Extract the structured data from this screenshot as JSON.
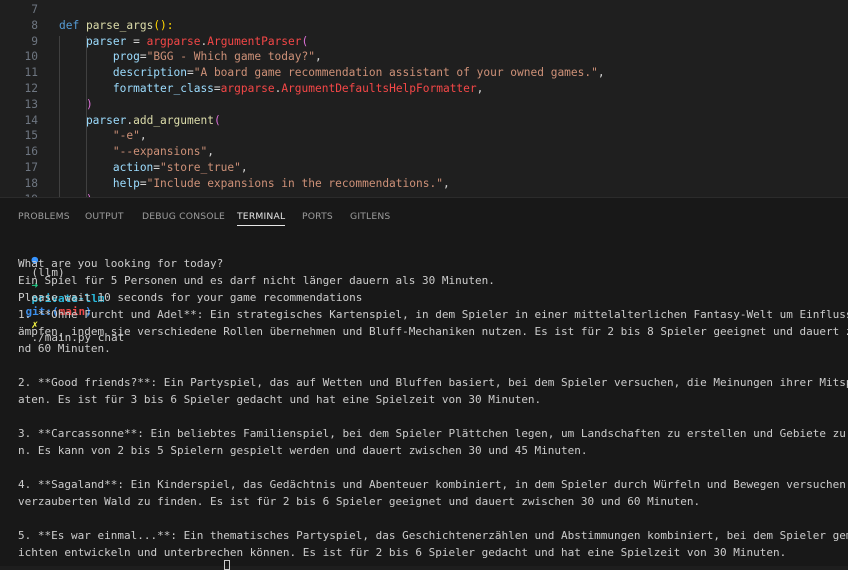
{
  "editor": {
    "lines": [
      {
        "num": "7",
        "tokens": []
      },
      {
        "num": "8",
        "tokens": [
          {
            "t": "def ",
            "c": "#569cd6"
          },
          {
            "t": "parse_args",
            "c": "#dcdcaa"
          },
          {
            "t": "():",
            "c": "#ffd700"
          }
        ]
      },
      {
        "num": "9",
        "tokens": [
          {
            "t": "    parser ",
            "c": "#9cdcfe"
          },
          {
            "t": "= ",
            "c": "#d4d4d4"
          },
          {
            "t": "argparse",
            "c": "#f44747"
          },
          {
            "t": ".",
            "c": "#d4d4d4"
          },
          {
            "t": "ArgumentParser",
            "c": "#f44747"
          },
          {
            "t": "(",
            "c": "#da70d6"
          }
        ]
      },
      {
        "num": "10",
        "tokens": [
          {
            "t": "        prog",
            "c": "#9cdcfe"
          },
          {
            "t": "=",
            "c": "#d4d4d4"
          },
          {
            "t": "\"BGG - Which game today?\"",
            "c": "#ce9178"
          },
          {
            "t": ",",
            "c": "#d4d4d4"
          }
        ]
      },
      {
        "num": "11",
        "tokens": [
          {
            "t": "        description",
            "c": "#9cdcfe"
          },
          {
            "t": "=",
            "c": "#d4d4d4"
          },
          {
            "t": "\"A board game recommendation assistant of your owned games.\"",
            "c": "#ce9178"
          },
          {
            "t": ",",
            "c": "#d4d4d4"
          }
        ]
      },
      {
        "num": "12",
        "tokens": [
          {
            "t": "        formatter_class",
            "c": "#9cdcfe"
          },
          {
            "t": "=",
            "c": "#d4d4d4"
          },
          {
            "t": "argparse",
            "c": "#f44747"
          },
          {
            "t": ".",
            "c": "#d4d4d4"
          },
          {
            "t": "ArgumentDefaultsHelpFormatter",
            "c": "#f44747"
          },
          {
            "t": ",",
            "c": "#d4d4d4"
          }
        ]
      },
      {
        "num": "13",
        "tokens": [
          {
            "t": "    )",
            "c": "#da70d6"
          }
        ]
      },
      {
        "num": "14",
        "tokens": [
          {
            "t": "    parser",
            "c": "#9cdcfe"
          },
          {
            "t": ".",
            "c": "#d4d4d4"
          },
          {
            "t": "add_argument",
            "c": "#dcdcaa"
          },
          {
            "t": "(",
            "c": "#da70d6"
          }
        ]
      },
      {
        "num": "15",
        "tokens": [
          {
            "t": "        \"-e\"",
            "c": "#ce9178"
          },
          {
            "t": ",",
            "c": "#d4d4d4"
          }
        ]
      },
      {
        "num": "16",
        "tokens": [
          {
            "t": "        \"--expansions\"",
            "c": "#ce9178"
          },
          {
            "t": ",",
            "c": "#d4d4d4"
          }
        ]
      },
      {
        "num": "17",
        "tokens": [
          {
            "t": "        action",
            "c": "#9cdcfe"
          },
          {
            "t": "=",
            "c": "#d4d4d4"
          },
          {
            "t": "\"store_true\"",
            "c": "#ce9178"
          },
          {
            "t": ",",
            "c": "#d4d4d4"
          }
        ]
      },
      {
        "num": "18",
        "tokens": [
          {
            "t": "        help",
            "c": "#9cdcfe"
          },
          {
            "t": "=",
            "c": "#d4d4d4"
          },
          {
            "t": "\"Include expansions in the recommendations.\"",
            "c": "#ce9178"
          },
          {
            "t": ",",
            "c": "#d4d4d4"
          }
        ]
      },
      {
        "num": "19",
        "tokens": [
          {
            "t": "    )",
            "c": "#da70d6"
          }
        ]
      }
    ]
  },
  "panel": {
    "tabs": [
      "PROBLEMS",
      "OUTPUT",
      "DEBUG CONSOLE",
      "TERMINAL",
      "PORTS",
      "GITLENS"
    ],
    "active_tab": "TERMINAL"
  },
  "terminal": {
    "prompt": {
      "env": "(llm)",
      "arrow": "➜",
      "dir": "private-llm",
      "git_label": "git:(",
      "branch": "main",
      "git_close": ")",
      "dirty": "✗",
      "command": "./main.py chat"
    },
    "lines": [
      "What are you looking for today?",
      "Ein Spiel für 5 Personen und es darf nicht länger dauern als 30 Minuten.",
      "Please wait 10 seconds for your game recommendations",
      "1. **Ohne Furcht und Adel**: Ein strategisches Kartenspiel, in dem Spieler in einer mittelalterlichen Fantasy-Welt um Einfluss und Macht k",
      "ämpfen, indem sie verschiedene Rollen übernehmen und Bluff-Mechaniken nutzen. Es ist für 2 bis 8 Spieler geeignet und dauert zwischen 20 u",
      "nd 60 Minuten.",
      "",
      "2. **Good friends?**: Ein Partyspiel, das auf Wetten und Bluffen basiert, bei dem Spieler versuchen, die Meinungen ihrer Mitspieler zu err",
      "aten. Es ist für 3 bis 6 Spieler gedacht und hat eine Spielzeit von 30 Minuten.",
      "",
      "3. **Carcassonne**: Ein beliebtes Familienspiel, bei dem Spieler Plättchen legen, um Landschaften zu erstellen und Gebiete zu kontrolliere",
      "n. Es kann von 2 bis 5 Spielern gespielt werden und dauert zwischen 30 und 45 Minuten.",
      "",
      "4. **Sagaland**: Ein Kinderspiel, das Gedächtnis und Abenteuer kombiniert, in dem Spieler durch Würfeln und Bewegen versuchen, Schätze im",
      "verzauberten Wald zu finden. Es ist für 2 bis 6 Spieler geeignet und dauert zwischen 30 und 60 Minuten.",
      "",
      "5. **Es war einmal...**: Ein thematisches Partyspiel, das Geschichtenerzählen und Abstimmungen kombiniert, bei dem Spieler gemeinsam Gesch",
      "ichten entwickeln und unterbrechen können. Es ist für 2 bis 6 Spieler gedacht und hat eine Spielzeit von 30 Minuten."
    ]
  }
}
